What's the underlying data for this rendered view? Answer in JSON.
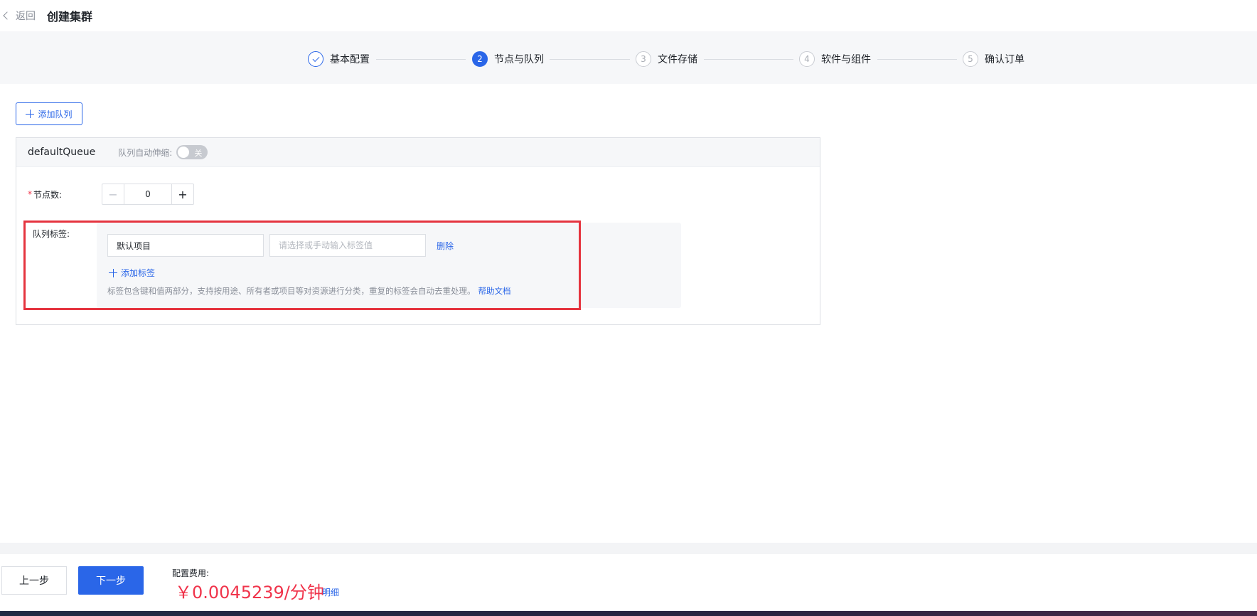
{
  "header": {
    "back_label": "返回",
    "title": "创建集群"
  },
  "steps": [
    {
      "number": "1",
      "label": "基本配置",
      "state": "done"
    },
    {
      "number": "2",
      "label": "节点与队列",
      "state": "active"
    },
    {
      "number": "3",
      "label": "文件存储",
      "state": "pending"
    },
    {
      "number": "4",
      "label": "软件与组件",
      "state": "pending"
    },
    {
      "number": "5",
      "label": "确认订单",
      "state": "pending"
    }
  ],
  "add_queue_label": "添加队列",
  "queue": {
    "name": "defaultQueue",
    "autoscale_label": "队列自动伸缩:",
    "autoscale_toggle_text": "关",
    "node_count_label": "节点数:",
    "required_mark": "*",
    "node_count_value": "0",
    "tags_label": "队列标签:",
    "tag_key_value": "默认项目",
    "tag_value_placeholder": "请选择或手动输入标签值",
    "delete_label": "删除",
    "add_tag_label": "添加标签",
    "tag_hint": "标签包含键和值两部分，支持按用途、所有者或项目等对资源进行分类，重复的标签会自动去重处理。",
    "help_doc_label": "帮助文档"
  },
  "footer": {
    "prev_label": "上一步",
    "next_label": "下一步",
    "fee_label": "配置费用:",
    "fee_price": "￥0.0045239/分钟",
    "detail_label": "明细"
  },
  "colors": {
    "primary": "#2a66e8",
    "price": "#f0344b",
    "highlight_border": "#e5343f"
  }
}
